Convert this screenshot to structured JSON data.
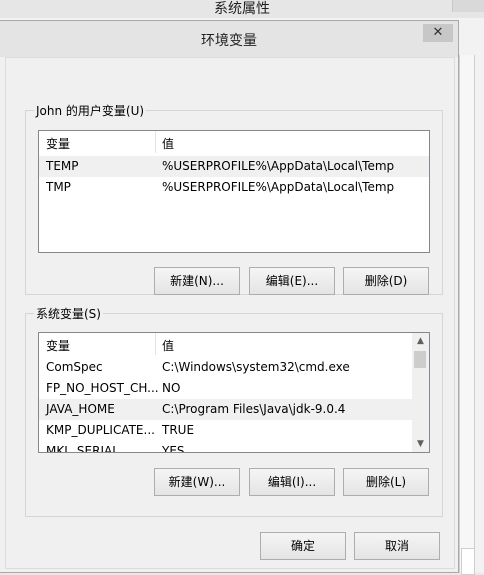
{
  "parent_window": {
    "title": "系统属性"
  },
  "env_dialog": {
    "title": "环境变量",
    "close_label": "✕",
    "user_vars": {
      "label": "John 的用户变量(U)",
      "columns": {
        "name": "变量",
        "value": "值"
      },
      "rows": [
        {
          "name": "TEMP",
          "value": "%USERPROFILE%\\AppData\\Local\\Temp",
          "selected": true
        },
        {
          "name": "TMP",
          "value": "%USERPROFILE%\\AppData\\Local\\Temp",
          "selected": false
        }
      ],
      "buttons": {
        "new": "新建(N)...",
        "edit": "编辑(E)...",
        "delete": "删除(D)"
      }
    },
    "system_vars": {
      "label": "系统变量(S)",
      "columns": {
        "name": "变量",
        "value": "值"
      },
      "rows": [
        {
          "name": "ComSpec",
          "value": "C:\\Windows\\system32\\cmd.exe",
          "selected": false
        },
        {
          "name": "FP_NO_HOST_CH...",
          "value": "NO",
          "selected": false
        },
        {
          "name": "JAVA_HOME",
          "value": "C:\\Program Files\\Java\\jdk-9.0.4",
          "selected": true
        },
        {
          "name": "KMP_DUPLICATE...",
          "value": "TRUE",
          "selected": false
        },
        {
          "name": "MKL_SERIAL",
          "value": "YES",
          "selected": false
        }
      ],
      "buttons": {
        "new": "新建(W)...",
        "edit": "编辑(I)...",
        "delete": "删除(L)"
      },
      "scroll": {
        "up": "▲",
        "down": "▼"
      }
    },
    "ok_label": "确定",
    "cancel_label": "取消"
  }
}
